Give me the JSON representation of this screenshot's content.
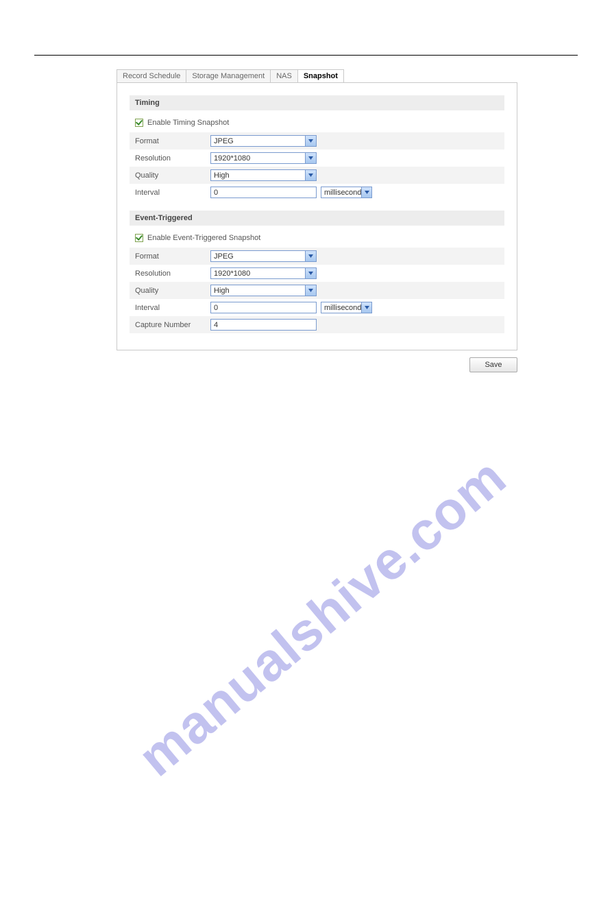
{
  "watermark": "manualshive.com",
  "tabs": [
    {
      "label": "Record Schedule"
    },
    {
      "label": "Storage Management"
    },
    {
      "label": "NAS"
    },
    {
      "label": "Snapshot"
    }
  ],
  "timing": {
    "header": "Timing",
    "enable_label": "Enable Timing Snapshot",
    "format_label": "Format",
    "format_value": "JPEG",
    "resolution_label": "Resolution",
    "resolution_value": "1920*1080",
    "quality_label": "Quality",
    "quality_value": "High",
    "interval_label": "Interval",
    "interval_value": "0",
    "interval_unit": "millisecond"
  },
  "event": {
    "header": "Event-Triggered",
    "enable_label": "Enable Event-Triggered Snapshot",
    "format_label": "Format",
    "format_value": "JPEG",
    "resolution_label": "Resolution",
    "resolution_value": "1920*1080",
    "quality_label": "Quality",
    "quality_value": "High",
    "interval_label": "Interval",
    "interval_value": "0",
    "interval_unit": "millisecond",
    "capture_label": "Capture Number",
    "capture_value": "4"
  },
  "save_label": "Save"
}
